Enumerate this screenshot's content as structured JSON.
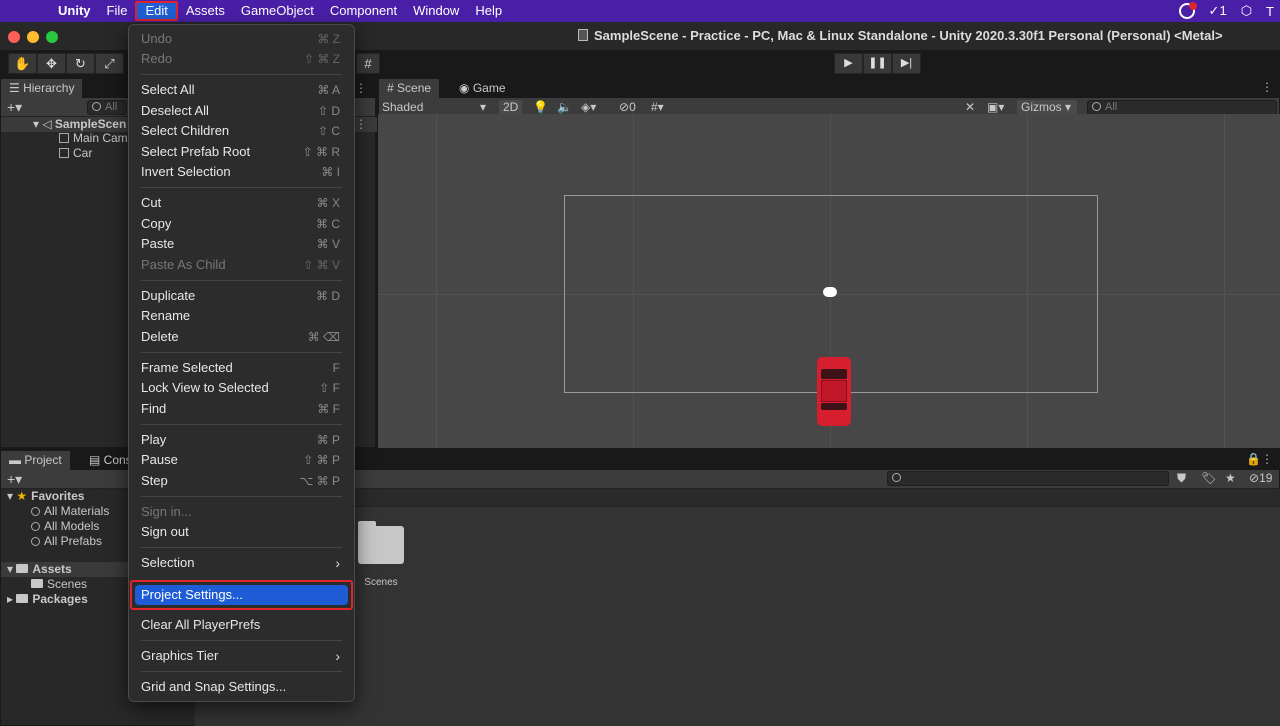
{
  "menubar": {
    "app": "Unity",
    "items": [
      "File",
      "Edit",
      "Assets",
      "GameObject",
      "Component",
      "Window",
      "Help"
    ],
    "right_badge": "1",
    "right_last": "T"
  },
  "window": {
    "title": "SampleScene - Practice - PC, Mac & Linux Standalone - Unity 2020.3.30f1 Personal (Personal) <Metal>"
  },
  "hierarchy": {
    "tab": "Hierarchy",
    "search_placeholder": "All",
    "scene": "SampleScen",
    "children": [
      "Main Cam",
      "Car"
    ]
  },
  "scene_view": {
    "tabs": [
      "Scene",
      "Game"
    ],
    "shading": "Shaded",
    "mode_2d": "2D",
    "hidden_count": "0",
    "gizmos": "Gizmos",
    "search_placeholder": "All"
  },
  "project": {
    "tabs": [
      "Project",
      "Consc"
    ],
    "favorites_label": "Favorites",
    "favorites": [
      "All Materials",
      "All Models",
      "All Prefabs"
    ],
    "assets_label": "Assets",
    "assets_children": [
      "Scenes"
    ],
    "packages_label": "Packages",
    "folder_item": "Scenes",
    "hidden_count": "19"
  },
  "edit_menu": {
    "items": [
      {
        "label": "Undo",
        "shortcut": "⌘ Z",
        "disabled": true
      },
      {
        "label": "Redo",
        "shortcut": "⇧ ⌘ Z",
        "disabled": true
      },
      {
        "label": "Select All",
        "shortcut": "⌘ A"
      },
      {
        "label": "Deselect All",
        "shortcut": "⇧ D"
      },
      {
        "label": "Select Children",
        "shortcut": "⇧ C"
      },
      {
        "label": "Select Prefab Root",
        "shortcut": "⇧ ⌘ R"
      },
      {
        "label": "Invert Selection",
        "shortcut": "⌘ I"
      },
      {
        "label": "Cut",
        "shortcut": "⌘ X"
      },
      {
        "label": "Copy",
        "shortcut": "⌘ C"
      },
      {
        "label": "Paste",
        "shortcut": "⌘ V"
      },
      {
        "label": "Paste As Child",
        "shortcut": "⇧ ⌘ V",
        "disabled": true
      },
      {
        "label": "Duplicate",
        "shortcut": "⌘ D"
      },
      {
        "label": "Rename",
        "shortcut": ""
      },
      {
        "label": "Delete",
        "shortcut": "⌘ ⌫"
      },
      {
        "label": "Frame Selected",
        "shortcut": "F"
      },
      {
        "label": "Lock View to Selected",
        "shortcut": "⇧ F"
      },
      {
        "label": "Find",
        "shortcut": "⌘ F"
      },
      {
        "label": "Play",
        "shortcut": "⌘ P"
      },
      {
        "label": "Pause",
        "shortcut": "⇧ ⌘ P"
      },
      {
        "label": "Step",
        "shortcut": "⌥ ⌘ P"
      },
      {
        "label": "Sign in...",
        "shortcut": "",
        "disabled": true
      },
      {
        "label": "Sign out",
        "shortcut": ""
      },
      {
        "label": "Selection",
        "shortcut": "",
        "submenu": true
      },
      {
        "label": "Project Settings...",
        "shortcut": "",
        "highlighted": true
      },
      {
        "label": "Clear All PlayerPrefs",
        "shortcut": ""
      },
      {
        "label": "Graphics Tier",
        "shortcut": "",
        "submenu": true
      },
      {
        "label": "Grid and Snap Settings...",
        "shortcut": ""
      }
    ]
  },
  "colors": {
    "menubar_bg": "#4a1fa8",
    "highlight": "#1d5cd4",
    "annotation_red": "#e0242b",
    "car_red": "#d51f2e"
  }
}
